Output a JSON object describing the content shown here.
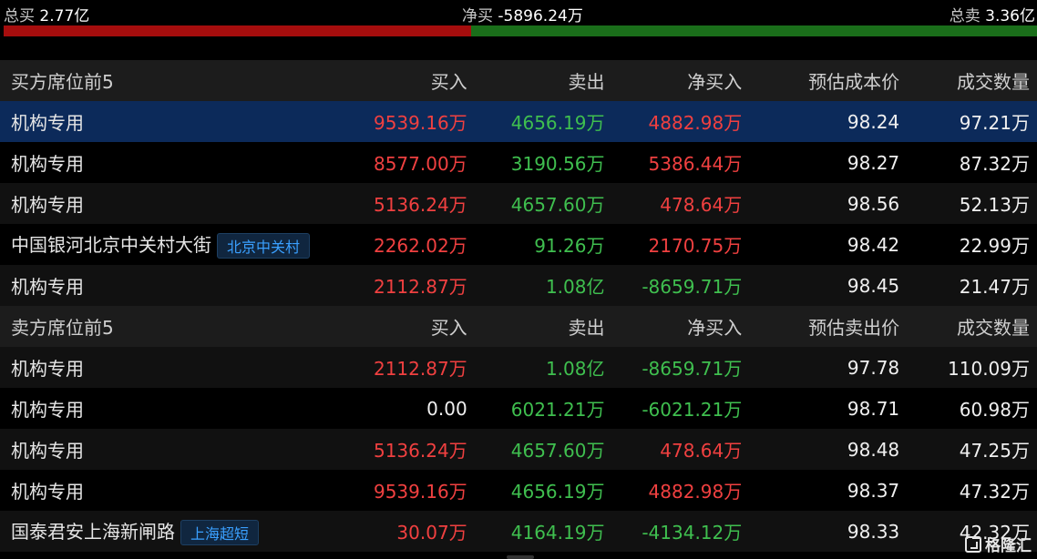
{
  "summary": {
    "total_buy_label": "总买",
    "total_buy_value": "2.77亿",
    "net_buy_label": "净买",
    "net_buy_value": "-5896.24万",
    "total_sell_label": "总卖",
    "total_sell_value": "3.36亿",
    "buy_ratio": 0.452,
    "buy_color": "#a50d0d",
    "sell_color": "#1a6e1a"
  },
  "buy_section": {
    "header": {
      "title": "买方席位前5",
      "buy": "买入",
      "sell": "卖出",
      "net": "净买入",
      "price": "预估成本价",
      "volume": "成交数量"
    },
    "rows": [
      {
        "name": "机构专用",
        "tag": "",
        "buy": "9539.16万",
        "sell": "4656.19万",
        "net": "4882.98万",
        "price": "98.24",
        "volume": "97.21万"
      },
      {
        "name": "机构专用",
        "tag": "",
        "buy": "8577.00万",
        "sell": "3190.56万",
        "net": "5386.44万",
        "price": "98.27",
        "volume": "87.32万"
      },
      {
        "name": "机构专用",
        "tag": "",
        "buy": "5136.24万",
        "sell": "4657.60万",
        "net": "478.64万",
        "price": "98.56",
        "volume": "52.13万"
      },
      {
        "name": "中国银河北京中关村大街",
        "tag": "北京中关村",
        "buy": "2262.02万",
        "sell": "91.26万",
        "net": "2170.75万",
        "price": "98.42",
        "volume": "22.99万"
      },
      {
        "name": "机构专用",
        "tag": "",
        "buy": "2112.87万",
        "sell": "1.08亿",
        "net": "-8659.71万",
        "price": "98.45",
        "volume": "21.47万"
      }
    ]
  },
  "sell_section": {
    "header": {
      "title": "卖方席位前5",
      "buy": "买入",
      "sell": "卖出",
      "net": "净买入",
      "price": "预估卖出价",
      "volume": "成交数量"
    },
    "rows": [
      {
        "name": "机构专用",
        "tag": "",
        "buy": "2112.87万",
        "sell": "1.08亿",
        "net": "-8659.71万",
        "price": "97.78",
        "volume": "110.09万"
      },
      {
        "name": "机构专用",
        "tag": "",
        "buy": "0.00",
        "sell": "6021.21万",
        "net": "-6021.21万",
        "price": "98.71",
        "volume": "60.98万"
      },
      {
        "name": "机构专用",
        "tag": "",
        "buy": "5136.24万",
        "sell": "4657.60万",
        "net": "478.64万",
        "price": "98.48",
        "volume": "47.25万"
      },
      {
        "name": "机构专用",
        "tag": "",
        "buy": "9539.16万",
        "sell": "4656.19万",
        "net": "4882.98万",
        "price": "98.37",
        "volume": "47.32万"
      },
      {
        "name": "国泰君安上海新闸路",
        "tag": "上海超短",
        "buy": "30.07万",
        "sell": "4164.19万",
        "net": "-4134.12万",
        "price": "98.33",
        "volume": "42.32万"
      }
    ]
  },
  "logo": {
    "text": "格隆汇"
  },
  "colors": {
    "up": "#f04040",
    "down": "#3fbf4f",
    "selected_row": "#0c2a5a",
    "tag_text": "#3aa0ff"
  }
}
